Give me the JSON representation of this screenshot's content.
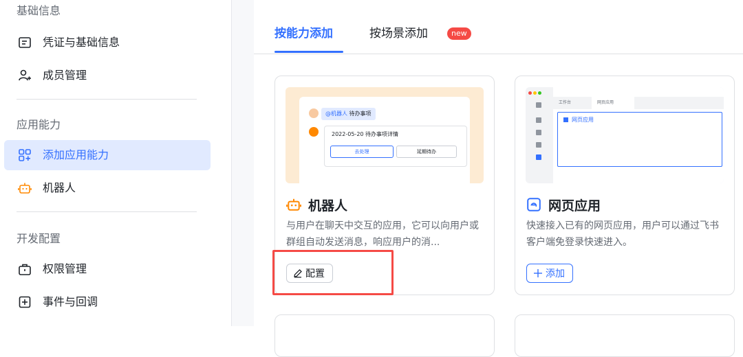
{
  "sidebar": {
    "sections": [
      {
        "title": "基础信息",
        "items": [
          {
            "label": "凭证与基础信息",
            "icon": "credential-icon"
          },
          {
            "label": "成员管理",
            "icon": "member-add-icon"
          }
        ]
      },
      {
        "title": "应用能力",
        "items": [
          {
            "label": "添加应用能力",
            "icon": "grid-add-icon",
            "active": true
          },
          {
            "label": "机器人",
            "icon": "robot-icon"
          }
        ]
      },
      {
        "title": "开发配置",
        "items": [
          {
            "label": "权限管理",
            "icon": "briefcase-icon"
          },
          {
            "label": "事件与回调",
            "icon": "event-plus-icon"
          }
        ]
      }
    ]
  },
  "main": {
    "tabs": [
      {
        "label": "按能力添加",
        "active": true
      },
      {
        "label": "按场景添加",
        "badge": "new"
      }
    ],
    "cards": [
      {
        "title": "机器人",
        "icon": "robot-icon",
        "description": "与用户在聊天中交互的应用，它可以向用户或群组自动发送消息，响应用户的消...",
        "button_label": "配置",
        "button_icon": "edit-icon",
        "preview": {
          "chip_mention": "@机器人",
          "chip_text": "待办事项",
          "date_line": "2022-05-20 待办事项详情",
          "btn_primary": "去处理",
          "btn_secondary": "延期待办"
        }
      },
      {
        "title": "网页应用",
        "icon": "web-app-icon",
        "description": "快速接入已有的网页应用，用户可以通过飞书客户端免登录快速进入。",
        "button_label": "添加",
        "button_icon": "plus-icon",
        "preview": {
          "tab1": "工作台",
          "tab2": "网页应用",
          "panel_label": "网页应用"
        }
      }
    ]
  },
  "colors": {
    "accent": "#3370ff",
    "badge": "#f54a45",
    "highlight": "#f54a45",
    "robot_orange": "#ff8800"
  }
}
